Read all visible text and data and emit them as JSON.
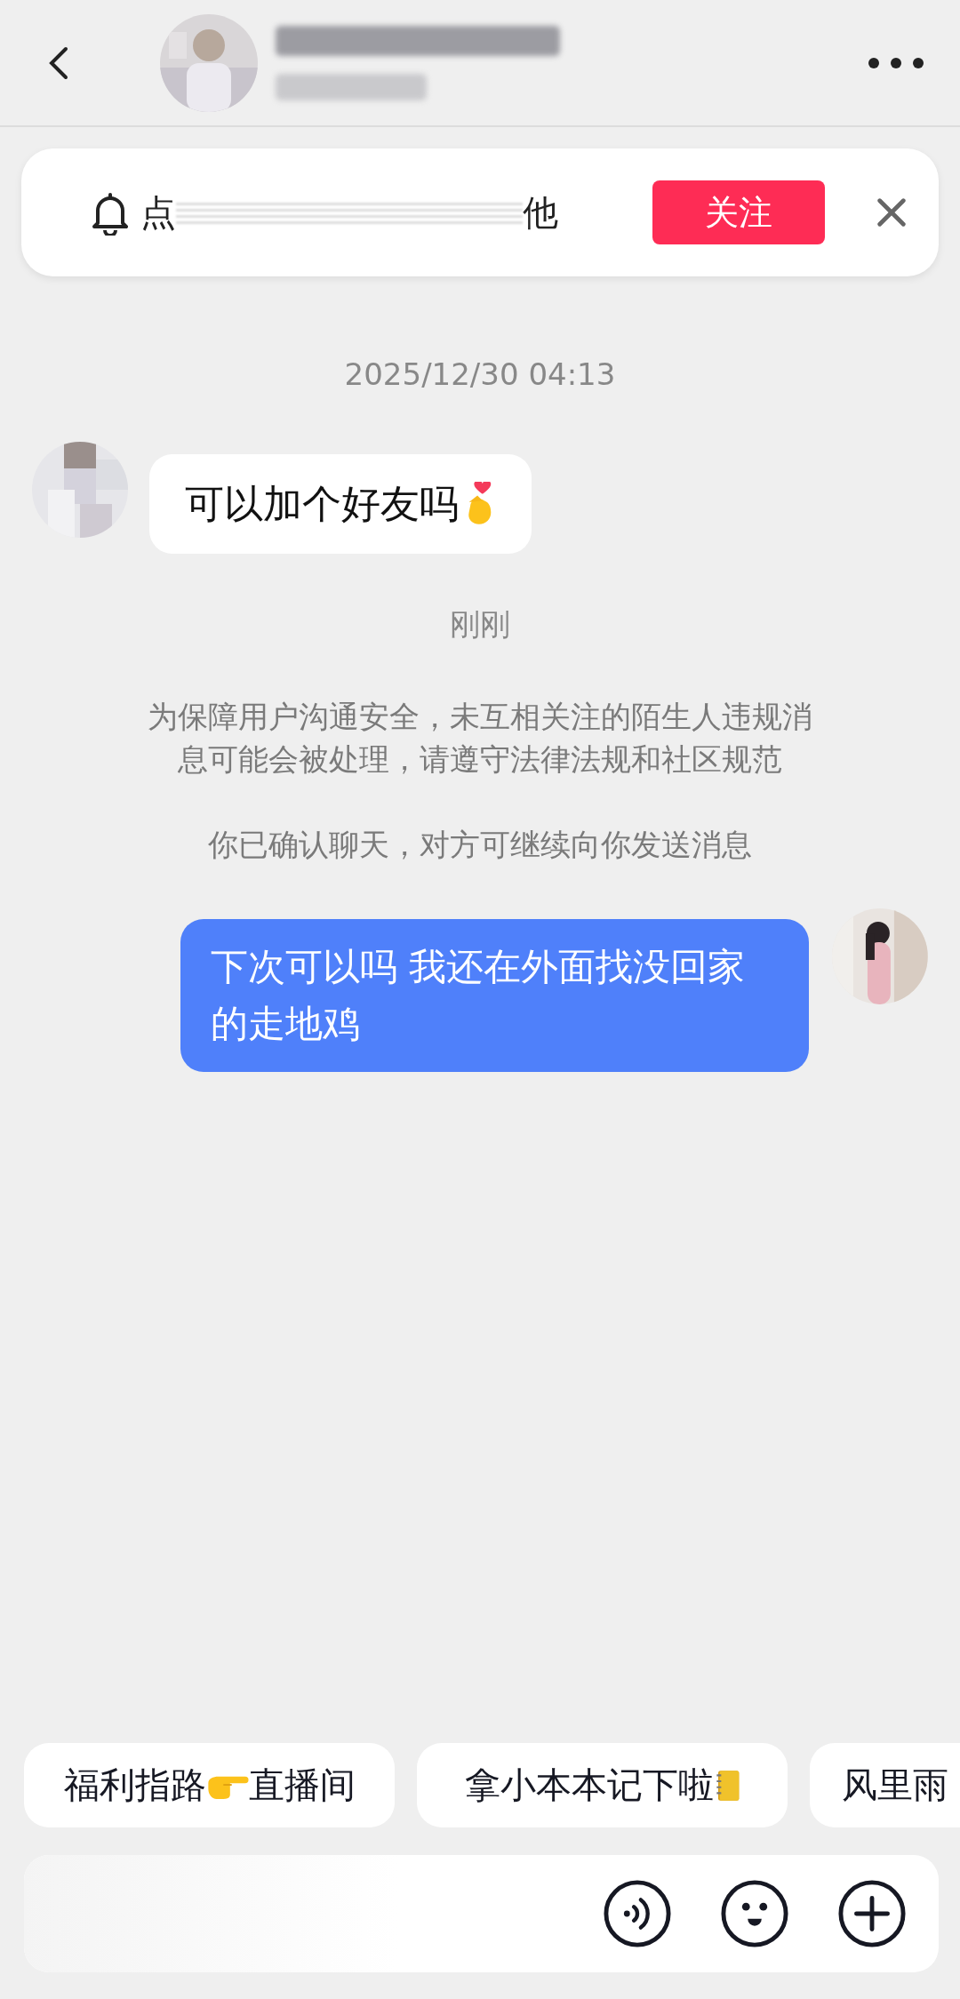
{
  "banner": {
    "text_start": "点",
    "text_end": "他",
    "follow_button": "关注"
  },
  "messages": [
    {
      "kind": "timestamp",
      "text": "2025/12/30 04:13"
    },
    {
      "kind": "incoming",
      "text": "可以加个好友吗",
      "emoji_icon": true
    },
    {
      "kind": "timestamp",
      "text": "刚刚"
    },
    {
      "kind": "notice",
      "text": "为保障用户沟通安全，未互相关注的陌生人违规消息可能会被处理，请遵守法律法规和社区规范"
    },
    {
      "kind": "notice",
      "text": "你已确认聊天，对方可继续向你发送消息"
    },
    {
      "kind": "outgoing",
      "text": "下次可以吗 我还在外面找没回家的走地鸡"
    }
  ],
  "quick_replies": [
    {
      "kind": "pointing",
      "label": "福利指路",
      "suffix": "直播间"
    },
    {
      "kind": "notebook",
      "label": "拿小本本记下啦"
    },
    {
      "kind": "plain",
      "label": "风里雨"
    }
  ]
}
